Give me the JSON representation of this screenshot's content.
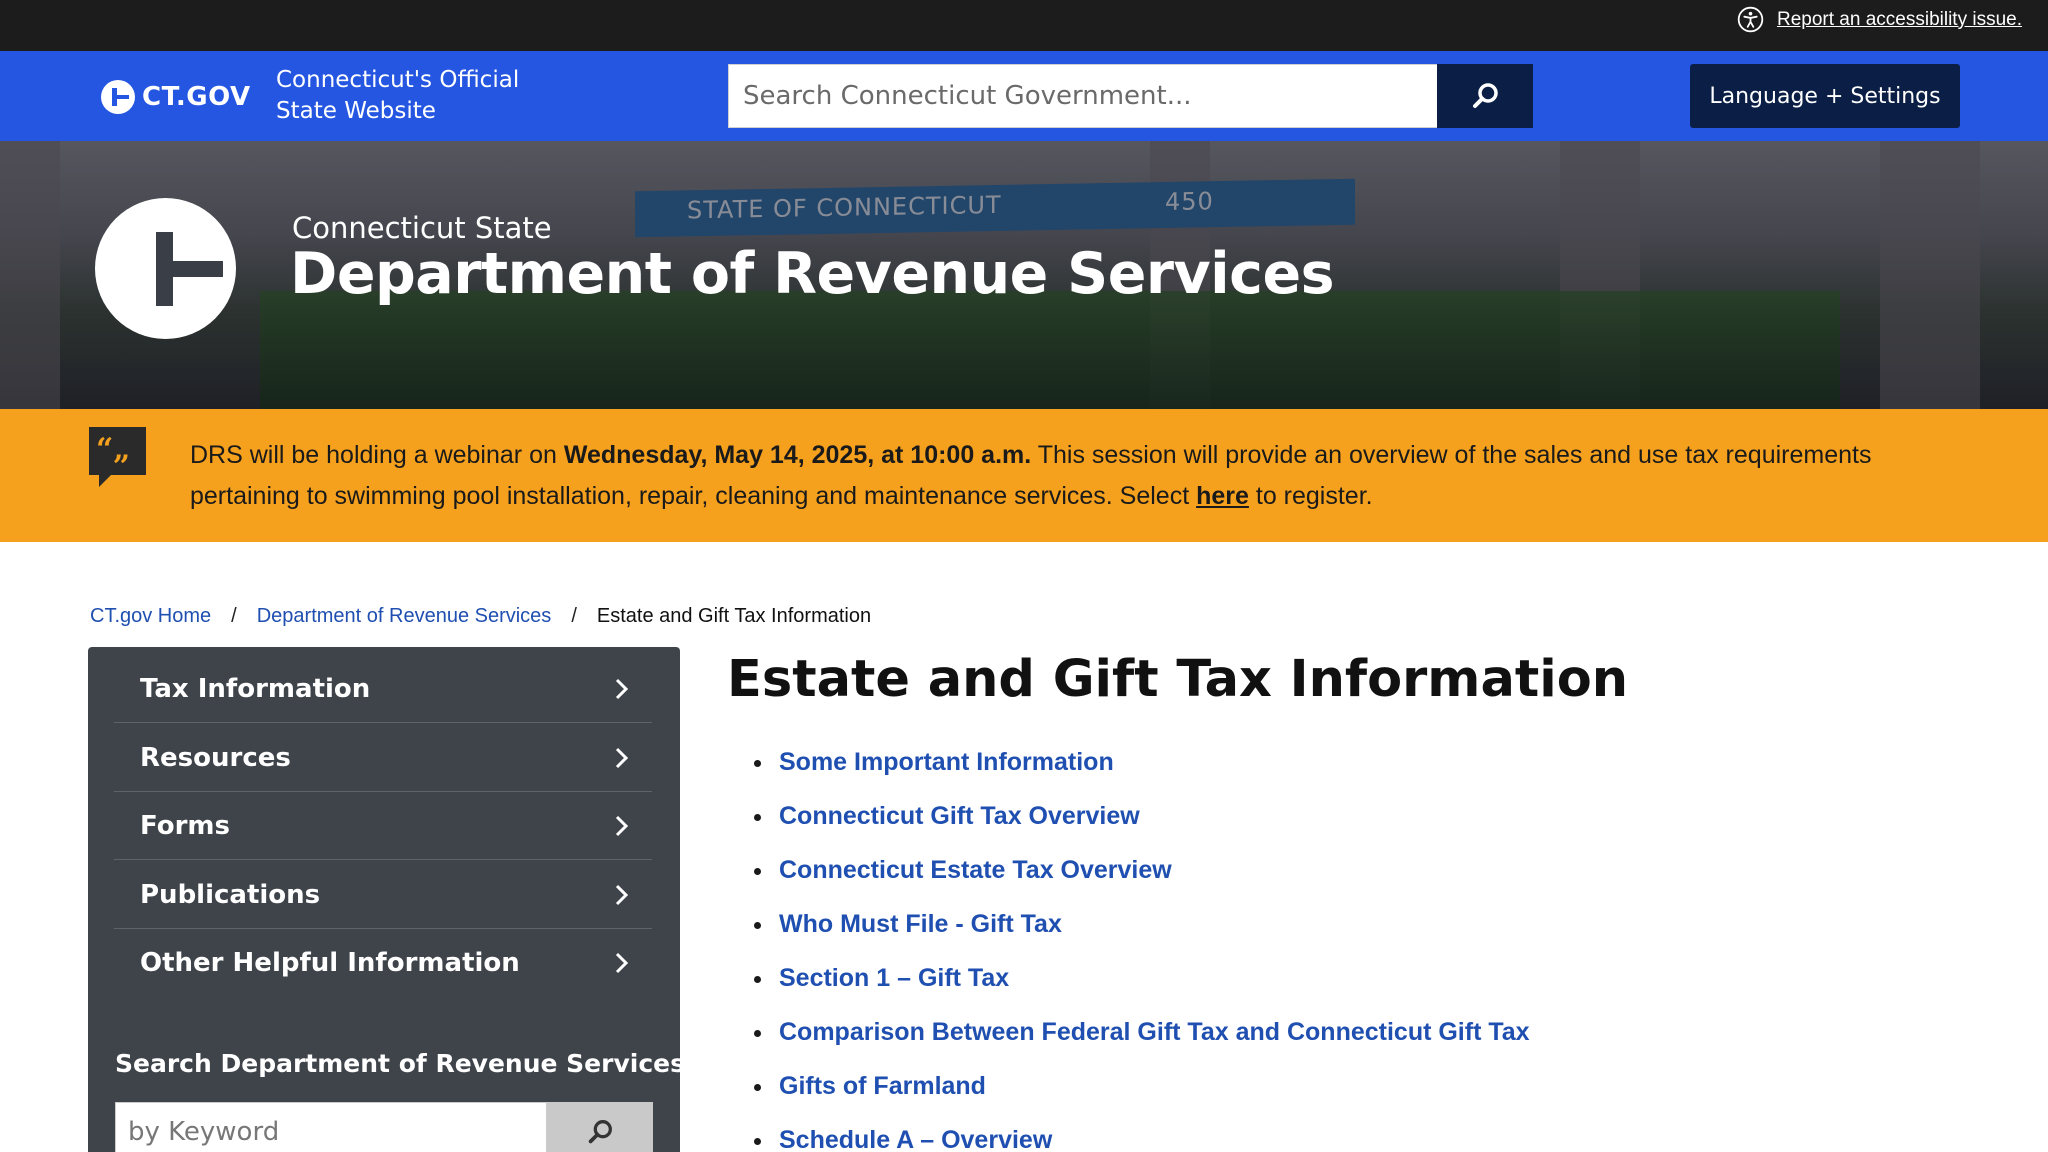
{
  "utility": {
    "accessibility_link": "Report an accessibility issue."
  },
  "header": {
    "logo_text": "CT.GOV",
    "tagline_line1": "Connecticut's Official",
    "tagline_line2": "State Website",
    "search_placeholder": "Search Connecticut Government...",
    "language_button": "Language + Settings"
  },
  "hero": {
    "kicker": "Connecticut State",
    "title": "Department of Revenue Services",
    "sign_text": "STATE OF CONNECTICUT",
    "sign_number": "450"
  },
  "alert": {
    "text_1": "DRS will be holding a webinar on ",
    "bold_date": "Wednesday, May 14, 2025, at 10:00 a.m.",
    "text_2": "  This session will provide an overview of the sales and use tax requirements pertaining to swimming pool installation, repair, cleaning and maintenance services.  Select ",
    "link_text": "here",
    "text_3": " to register."
  },
  "breadcrumb": {
    "home": "CT.gov Home",
    "sep": "/",
    "department": "Department of Revenue Services",
    "current": "Estate and Gift Tax Information"
  },
  "sidebar": {
    "items": [
      {
        "label": "Tax Information"
      },
      {
        "label": "Resources"
      },
      {
        "label": "Forms"
      },
      {
        "label": "Publications"
      },
      {
        "label": "Other Helpful Information"
      }
    ],
    "search_title": "Search Department of Revenue Services",
    "search_placeholder": "by Keyword"
  },
  "main": {
    "title": "Estate and Gift Tax Information",
    "links": [
      "Some Important Information",
      "Connecticut Gift Tax Overview",
      "Connecticut Estate Tax Overview",
      "Who Must File - Gift Tax",
      "Section 1 – Gift Tax",
      "Comparison Between Federal Gift Tax and Connecticut Gift Tax",
      "Gifts of Farmland",
      "Schedule A – Overview"
    ]
  },
  "colors": {
    "header_blue": "#2456e2",
    "navy": "#0b1e45",
    "alert_orange": "#f5a11e",
    "sidebar_gray": "#3f444b",
    "link_blue": "#1f4fb0"
  },
  "icons": {
    "accessibility": "accessibility-icon",
    "search": "search-icon",
    "chevron": "chevron-right-icon",
    "quote": "quote-icon"
  }
}
